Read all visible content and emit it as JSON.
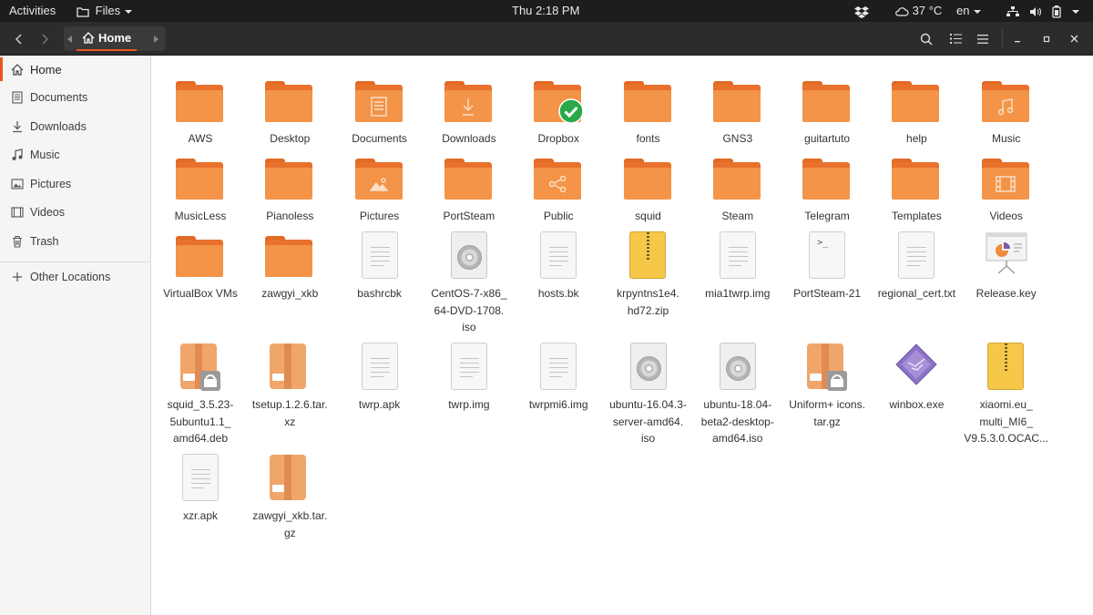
{
  "topbar": {
    "activities": "Activities",
    "app_name": "Files",
    "clock": "Thu  2:18 PM",
    "temperature": "37 °C",
    "language": "en"
  },
  "header": {
    "breadcrumb": "Home"
  },
  "sidebar": {
    "items": [
      {
        "label": "Home",
        "icon": "home-icon"
      },
      {
        "label": "Documents",
        "icon": "document-icon"
      },
      {
        "label": "Downloads",
        "icon": "download-icon"
      },
      {
        "label": "Music",
        "icon": "music-icon"
      },
      {
        "label": "Pictures",
        "icon": "picture-icon"
      },
      {
        "label": "Videos",
        "icon": "video-icon"
      },
      {
        "label": "Trash",
        "icon": "trash-icon"
      }
    ],
    "other_locations": "Other Locations"
  },
  "files": [
    {
      "name": "AWS",
      "type": "folder"
    },
    {
      "name": "Desktop",
      "type": "folder"
    },
    {
      "name": "Documents",
      "type": "folder-documents"
    },
    {
      "name": "Downloads",
      "type": "folder-downloads"
    },
    {
      "name": "Dropbox",
      "type": "folder-dropbox"
    },
    {
      "name": "fonts",
      "type": "folder"
    },
    {
      "name": "GNS3",
      "type": "folder"
    },
    {
      "name": "guitartuto",
      "type": "folder"
    },
    {
      "name": "help",
      "type": "folder"
    },
    {
      "name": "Music",
      "type": "folder-music"
    },
    {
      "name": "MusicLess",
      "type": "folder"
    },
    {
      "name": "Pianoless",
      "type": "folder"
    },
    {
      "name": "Pictures",
      "type": "folder-pictures"
    },
    {
      "name": "PortSteam",
      "type": "folder"
    },
    {
      "name": "Public",
      "type": "folder-public"
    },
    {
      "name": "squid",
      "type": "folder"
    },
    {
      "name": "Steam",
      "type": "folder"
    },
    {
      "name": "Telegram",
      "type": "folder"
    },
    {
      "name": "Templates",
      "type": "folder"
    },
    {
      "name": "Videos",
      "type": "folder-videos"
    },
    {
      "name": "VirtualBox VMs",
      "type": "folder"
    },
    {
      "name": "zawgyi_xkb",
      "type": "folder"
    },
    {
      "name": "bashrcbk",
      "type": "text"
    },
    {
      "name": "CentOS-7-x86_\n64-DVD-1708.\niso",
      "type": "disc"
    },
    {
      "name": "hosts.bk",
      "type": "text"
    },
    {
      "name": "krpyntns1e4.\nhd72.zip",
      "type": "zip"
    },
    {
      "name": "mia1twrp.img",
      "type": "text"
    },
    {
      "name": "PortSteam-21",
      "type": "terminal"
    },
    {
      "name": "regional_cert.txt",
      "type": "text"
    },
    {
      "name": "Release.key",
      "type": "presentation"
    },
    {
      "name": "squid_3.5.23-\n5ubuntu1.1_\namd64.deb",
      "type": "package-locked"
    },
    {
      "name": "tsetup.1.2.6.tar.\nxz",
      "type": "package"
    },
    {
      "name": "twrp.apk",
      "type": "text"
    },
    {
      "name": "twrp.img",
      "type": "text"
    },
    {
      "name": "twrpmi6.img",
      "type": "text"
    },
    {
      "name": "ubuntu-16.04.3-\nserver-amd64.\niso",
      "type": "disc"
    },
    {
      "name": "ubuntu-18.04-\nbeta2-desktop-\namd64.iso",
      "type": "disc"
    },
    {
      "name": "Uniform+ icons.\ntar.gz",
      "type": "package-locked"
    },
    {
      "name": "winbox.exe",
      "type": "exe"
    },
    {
      "name": "xiaomi.eu_\nmulti_MI6_\nV9.5.3.0.OCAC...",
      "type": "zip"
    },
    {
      "name": "xzr.apk",
      "type": "text"
    },
    {
      "name": "zawgyi_xkb.tar.\ngz",
      "type": "package"
    }
  ]
}
